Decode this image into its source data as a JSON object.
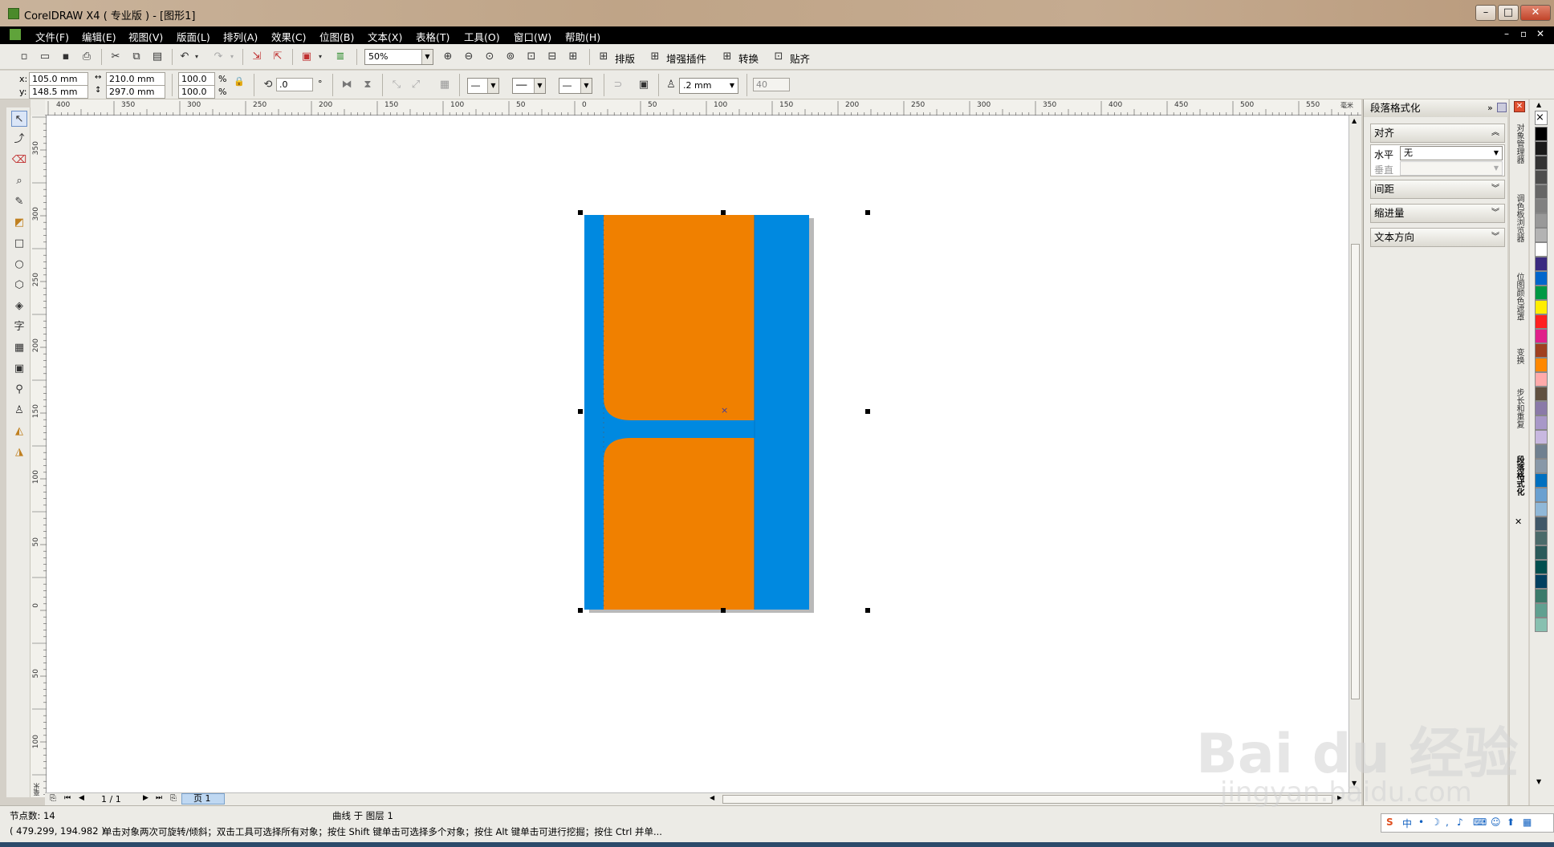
{
  "window": {
    "title": "CorelDRAW X4 ( 专业版 ) - [图形1]",
    "controls": [
      "–",
      "□",
      "✕"
    ]
  },
  "menu": {
    "items": [
      "文件(F)",
      "编辑(E)",
      "视图(V)",
      "版面(L)",
      "排列(A)",
      "效果(C)",
      "位图(B)",
      "文本(X)",
      "表格(T)",
      "工具(O)",
      "窗口(W)",
      "帮助(H)"
    ],
    "doc_controls": [
      "–",
      "▫",
      "✕"
    ]
  },
  "toolbar": {
    "zoom": "50%",
    "plugins": [
      "排版",
      "增强插件",
      "转换",
      "贴齐"
    ]
  },
  "propbar": {
    "x_label": "x:",
    "x": "105.0 mm",
    "y_label": "y:",
    "y": "148.5 mm",
    "w": "210.0 mm",
    "h": "297.0 mm",
    "sx": "100.0",
    "sy": "100.0",
    "pct": "%",
    "angle": ".0",
    "deg": "°",
    "outline": ".2 mm",
    "num": "40"
  },
  "rulers": {
    "h_ticks": [
      "400",
      "350",
      "300",
      "250",
      "200",
      "150",
      "100",
      "50",
      "0",
      "50",
      "100",
      "150",
      "200",
      "250",
      "300",
      "350",
      "400",
      "450",
      "500",
      "550"
    ],
    "h_unit": "毫米",
    "v_ticks": [
      "350",
      "300",
      "250",
      "200",
      "150",
      "100",
      "50",
      "0",
      "50",
      "100"
    ],
    "v_unit": "毫米"
  },
  "docker": {
    "title": "段落格式化",
    "align_section": "对齐",
    "horizontal_label": "水平",
    "horizontal_value": "无",
    "vertical_label": "垂直",
    "sections": [
      "间距",
      "缩进量",
      "文本方向"
    ]
  },
  "docker_tabs": [
    "对象管理器",
    "调色板浏览器",
    "位图颜色遮罩",
    "变换",
    "步长和重复",
    "段落格式化"
  ],
  "page_nav": {
    "page_count": "1 / 1",
    "page_tab": "页 1"
  },
  "status": {
    "nodes": "节点数: 14",
    "coords": "( 479.299, 194.982 )",
    "layer": "曲线 于 图层 1",
    "hint": "单击对象两次可旋转/倾斜；双击工具可选择所有对象；按住 Shift 键单击可选择多个对象；按住 Alt 键单击可进行挖掘；按住 Ctrl 并单..."
  },
  "ime": {
    "label": "中"
  },
  "watermark": {
    "text": "Bai du 经验",
    "url": "jingyan.baidu.com"
  },
  "colors": {
    "blue": "#0089e0",
    "orange": "#f08000",
    "menubar": "#000000",
    "ui": "#ecebe6"
  }
}
